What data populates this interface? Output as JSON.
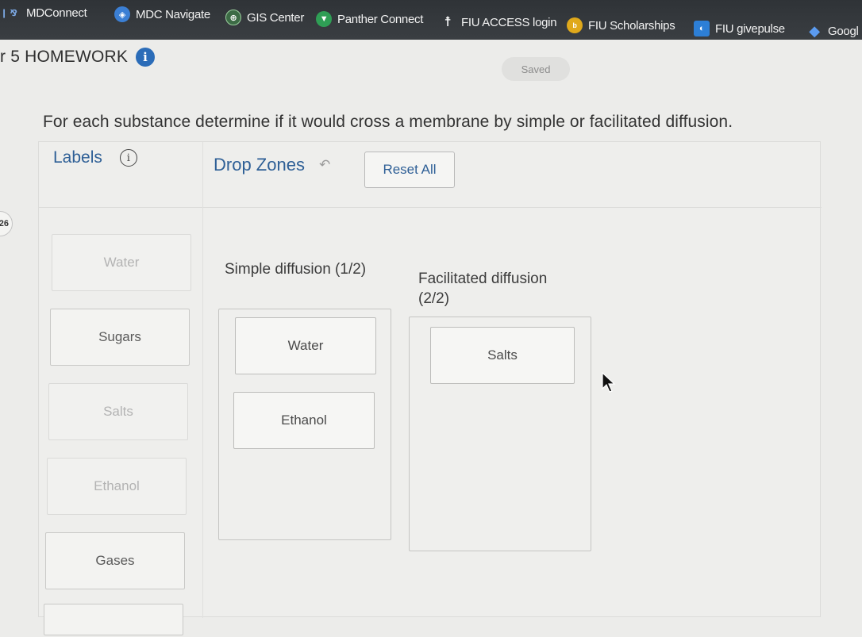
{
  "bookmarks": [
    {
      "label": "MDConnect",
      "icon": "mdconnect-icon"
    },
    {
      "label": "MDC Navigate",
      "icon": "navigate-icon"
    },
    {
      "label": "GIS Center",
      "icon": "globe-icon"
    },
    {
      "label": "Panther Connect",
      "icon": "panther-icon"
    },
    {
      "label": "FIU ACCESS login",
      "icon": "accessibility-icon"
    },
    {
      "label": "FIU Scholarships",
      "icon": "scholarships-icon"
    },
    {
      "label": "FIU givepulse",
      "icon": "givepulse-icon"
    },
    {
      "label": "Googl",
      "icon": "google-icon"
    }
  ],
  "header": {
    "title": "r 5 HOMEWORK",
    "info_glyph": "i",
    "saved_status": "Saved"
  },
  "question": {
    "number": "26",
    "prompt": "For each substance determine if it would cross a membrane by simple or facilitated diffusion."
  },
  "labels_panel": {
    "heading": "Labels",
    "info_glyph": "i",
    "items": [
      {
        "text": "Water",
        "used": true
      },
      {
        "text": "Sugars",
        "used": false
      },
      {
        "text": "Salts",
        "used": true
      },
      {
        "text": "Ethanol",
        "used": true
      },
      {
        "text": "Gases",
        "used": false
      },
      {
        "text": "",
        "used": false
      }
    ]
  },
  "drop_zones": {
    "heading": "Drop Zones",
    "undo_glyph": "↶",
    "reset_label": "Reset All",
    "zones": [
      {
        "title": "Simple diffusion (1/2)",
        "items": [
          "Water",
          "Ethanol"
        ]
      },
      {
        "title_line1": "Facilitated diffusion",
        "title_line2": "(2/2)",
        "items": [
          "Salts"
        ]
      }
    ]
  },
  "colors": {
    "accent": "#2e5f96",
    "info_badge": "#2b6cb8",
    "bookmark_bar": "#2f3337"
  }
}
